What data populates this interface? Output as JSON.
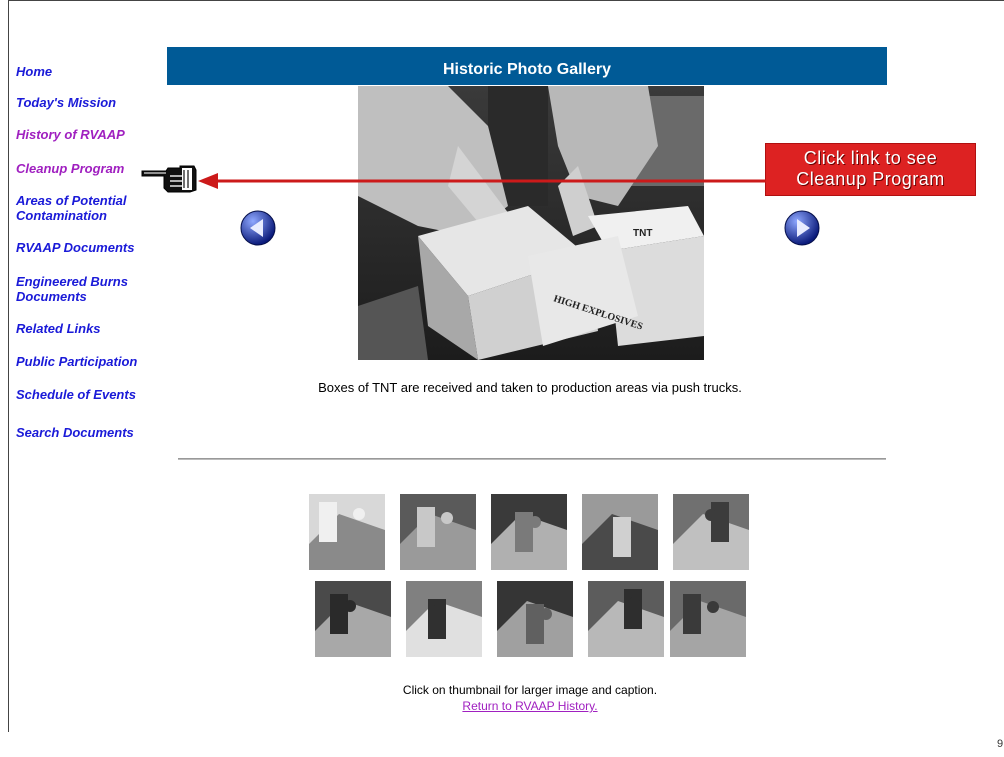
{
  "sidebar": {
    "items": [
      {
        "label": "Home"
      },
      {
        "label": "Today's Mission"
      },
      {
        "label": "History of RVAAP"
      },
      {
        "label": "Cleanup Program"
      },
      {
        "label": "Areas of Potential Contamination"
      },
      {
        "label": "RVAAP Documents"
      },
      {
        "label": "Engineered Burns Documents"
      },
      {
        "label": "Related Links"
      },
      {
        "label": "Public Participation"
      },
      {
        "label": "Schedule of Events"
      },
      {
        "label": "Search Documents"
      }
    ]
  },
  "gallery": {
    "title": "Historic Photo Gallery",
    "caption": "Boxes of TNT are received and taken to production areas via push trucks.",
    "thumb_hint": "Click on thumbnail for larger image and caption.",
    "return_link": "Return to RVAAP History.",
    "thumbnails_count": 10
  },
  "callout": {
    "line1": "Click link to see",
    "line2": "Cleanup Program"
  },
  "photo_text": {
    "box1": "HIGH EXPLOSIVES",
    "box2": "TNT"
  },
  "page_number": "9",
  "colors": {
    "header_bar": "#005a96",
    "link": "#1a1ad8",
    "visited_link": "#a020c0",
    "callout": "#dd2222"
  }
}
